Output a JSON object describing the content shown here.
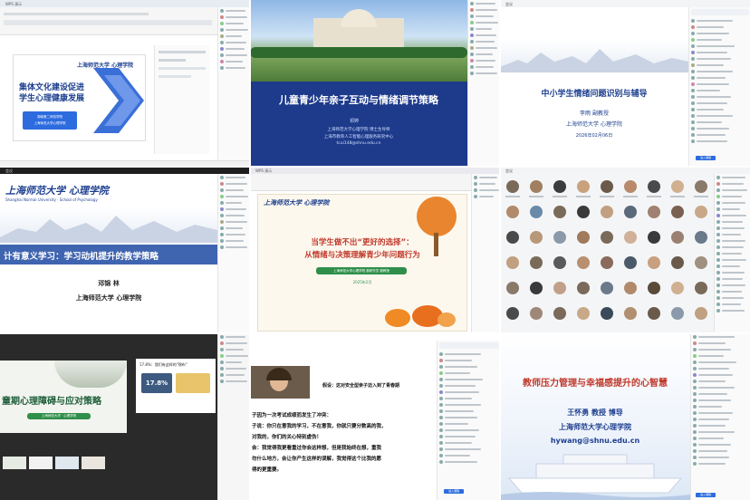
{
  "tiles": {
    "t1": {
      "title": "集体文化建设促进学生心理健康发展",
      "logo": "上海师范大学 心理学院",
      "badge_lines": [
        "湖南第二师范学院",
        "上海师范大学心理学院"
      ]
    },
    "t2": {
      "title": "儿童青少年亲子互动与情绪调节策略",
      "speaker": "祁婷",
      "lines": [
        "上海师范大学心理学院 博士生导师",
        "上海市教育人工智能心理服务研究中心",
        "tcui148@shnu.edu.cn"
      ]
    },
    "t3": {
      "title": "中小学生情绪问题识别与辅导",
      "speaker": "李雨 副教授",
      "org": "上海师范大学 心理学院",
      "date": "2026年02月06日",
      "button": "进入课程"
    },
    "t4": {
      "logo": "上海师范大学 心理学院",
      "logo_en": "Shanghai Normal University · School of Psychology",
      "title": "计有意义学习：学习动机提升的教学策略",
      "speaker": "邓锦 林",
      "org": "上海师范大学 心理学院"
    },
    "t5": {
      "logo": "上海师范大学 心理学院",
      "title_line1": "当学生做不出“更好的选择”：",
      "title_line2": "从情绪与决策理解青少年问题行为",
      "sub": "上海师范大学心理学院 副研究员 副教授",
      "sub2": "2025年2月"
    },
    "t6": {
      "label": "视频会议画面"
    },
    "t7": {
      "title": "童期心理障碍与应对策略",
      "label_top": "17.8%：我们有这样的“锦布”",
      "stat": "17.8%",
      "caption": "上海师范大学 · 心理学院"
    },
    "t8": {
      "heading": "假设：这对安全型亲子迈入到了青春期",
      "lines": [
        "子因为一次考试成绩而发生了冲突：",
        "子说：你只在意我的学习，不在意我，你就只要分数高的我，",
        "对我的，你们的关心特别虚伪！",
        "会：我觉得我更看重过你会这样想，但是我始终在想，重我",
        "勿什么地方，会让你产生这样的误解，我觉得这个比我的愿",
        "得的更重要。"
      ],
      "button": "进入课程"
    },
    "t9": {
      "title": "教师压力管理与幸福感提升的心智慧",
      "speaker": "王怀勇 教授 博导",
      "org": "上海师范大学心理学院",
      "email": "hywang@shnu.edu.cn",
      "button": "进入课程"
    }
  },
  "colors": {
    "blue": "#2d6cdf",
    "navy": "#1d3f8f",
    "orange": "#f08a24",
    "red": "#c0392b",
    "green": "#2f8f4a"
  }
}
